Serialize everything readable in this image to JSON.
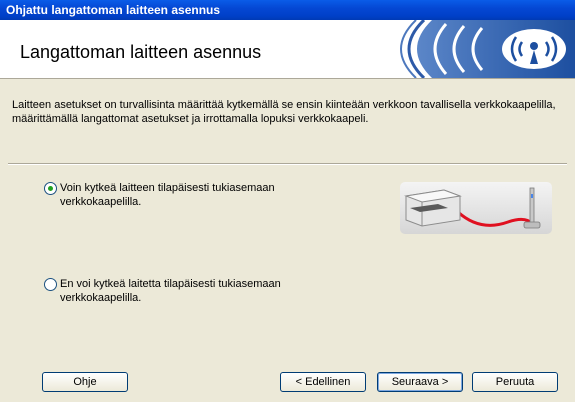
{
  "window": {
    "title": "Ohjattu langattoman laitteen asennus"
  },
  "header": {
    "title": "Langattoman laitteen asennus"
  },
  "intro_text": "Laitteen asetukset on turvallisinta määrittää  kytkemällä se ensin kiinteään verkkoon tavallisella verkkokaapelilla, määrittämällä langattomat asetukset ja irrottamalla lopuksi verkkokaapeli.",
  "options": [
    {
      "label": "Voin kytkeä laitteen tilapäisesti tukiasemaan verkkokaapelilla.",
      "selected": true
    },
    {
      "label": "En voi kytkeä laitetta tilapäisesti tukiasemaan verkkokaapelilla.",
      "selected": false
    }
  ],
  "buttons": {
    "help": "Ohje",
    "back": "< Edellinen",
    "next": "Seuraava >",
    "cancel": "Peruuta"
  },
  "icons": {
    "logo": "wireless-logo-icon",
    "illustration": "printer-cable-access-point-icon"
  },
  "colors": {
    "titlebar": "#0548d4",
    "cable": "#e01020",
    "radio_dot": "#21a121"
  }
}
